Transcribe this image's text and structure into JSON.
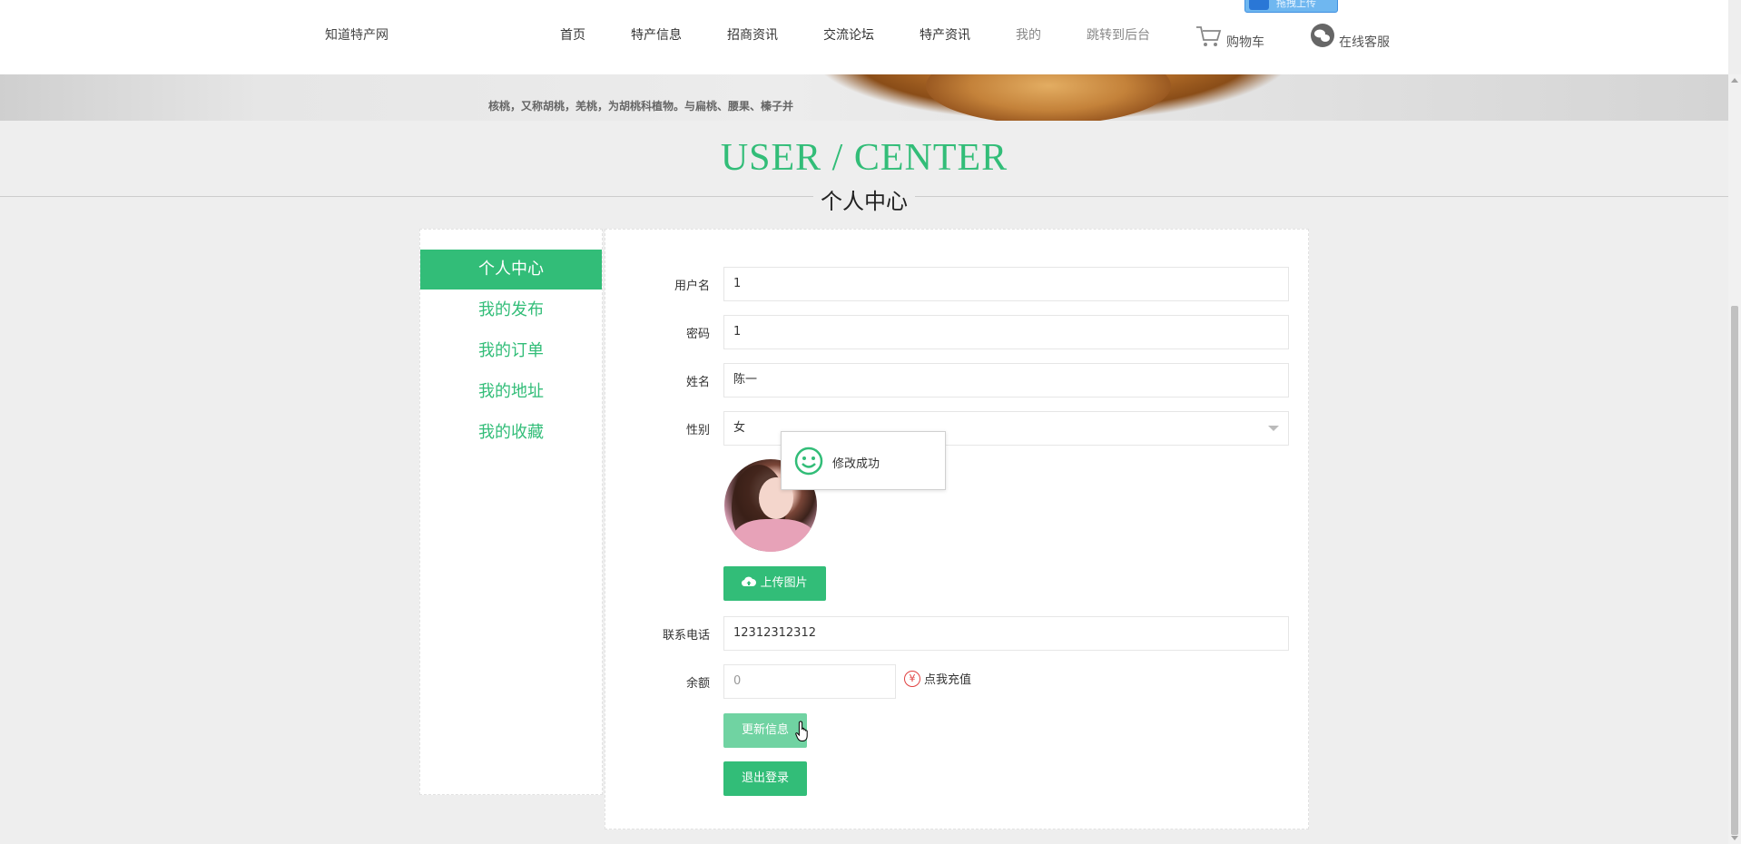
{
  "header": {
    "site_name": "知道特产网",
    "nav": [
      "首页",
      "特产信息",
      "招商资讯",
      "交流论坛",
      "特产资讯",
      "我的",
      "跳转到后台"
    ],
    "cart_label": "购物车",
    "service_label": "在线客服",
    "upload_badge": "拖拽上传"
  },
  "banner": {
    "text": "核桃，又称胡桃，羌桃，为胡桃科植物。与扁桃、腰果、榛子并"
  },
  "title": {
    "en": "USER / CENTER",
    "cn": "个人中心"
  },
  "sidebar": {
    "items": [
      "个人中心",
      "我的发布",
      "我的订单",
      "我的地址",
      "我的收藏"
    ],
    "active_index": 0
  },
  "form": {
    "username_label": "用户名",
    "username_value": "1",
    "password_label": "密码",
    "password_value": "1",
    "name_label": "姓名",
    "name_value": "陈一",
    "gender_label": "性别",
    "gender_value": "女",
    "upload_button": "上传图片",
    "phone_label": "联系电话",
    "phone_value": "12312312312",
    "balance_label": "余额",
    "balance_value": "0",
    "recharge_label": "点我充值",
    "update_button": "更新信息",
    "logout_button": "退出登录"
  },
  "toast": {
    "message": "修改成功"
  },
  "colors": {
    "accent": "#32bd78",
    "accent_light": "#70d3a2",
    "recharge_icon": "#e04040"
  },
  "icons": {
    "cart": "cart-icon",
    "service": "wechat-icon",
    "upload": "cloud-upload-icon",
    "recharge": "yen-icon",
    "toast": "smile-icon"
  }
}
